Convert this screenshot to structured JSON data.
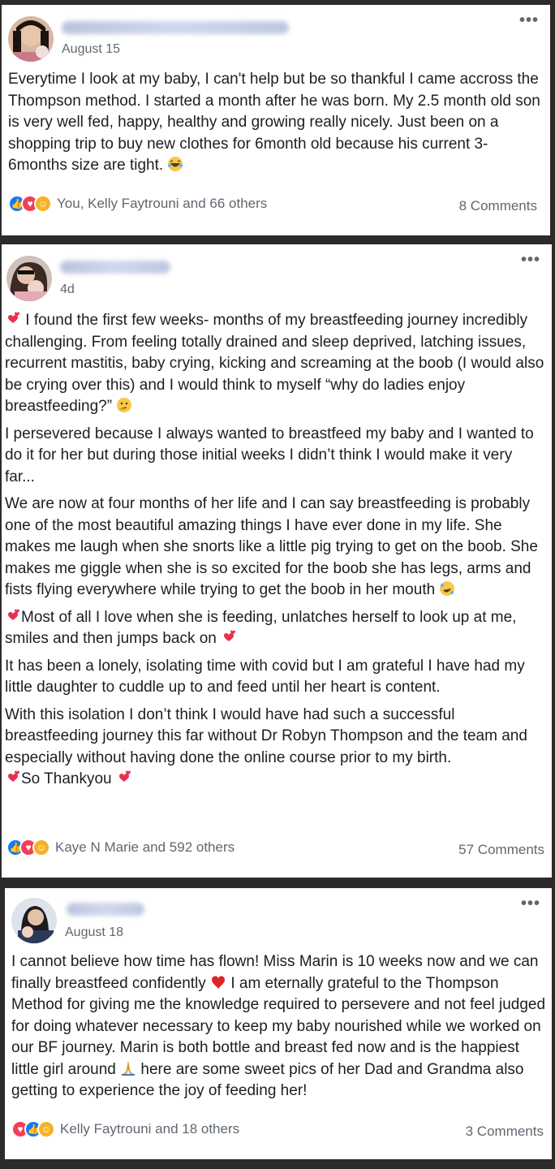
{
  "posts": [
    {
      "date": "August 15",
      "paragraphs": [
        "Everytime I look at my baby, I can't help but be so thankful I came accross the Thompson method. I started a month after he was born. My 2.5 month old son is very well fed, happy, healthy and growing really nicely. Just been on a shopping trip to buy new clothes for 6month old because his current 3-6months size are tight."
      ],
      "reactions_text": "You, Kelly Faytrouni and 66 others",
      "comments": "8 Comments"
    },
    {
      "date": "4d",
      "paragraphs": [
        "I found the first few weeks- months of my breastfeeding journey incredibly challenging. From feeling totally drained and sleep deprived, latching issues, recurrent mastitis, baby crying, kicking and screaming at the boob (I would also be crying over this) and I would think to myself “why do ladies enjoy breastfeeding?”",
        "I persevered because I always wanted to breastfeed my baby and I wanted to do it for her but during those initial weeks I didn’t think I would make it very far...",
        "We are now at four months of her life and I can say breastfeeding is probably one of the most beautiful amazing things I have ever done in my life. She makes me laugh when she snorts like a little pig trying to get on the boob. She makes me giggle when she is so excited for the boob she has legs, arms and fists flying everywhere while trying to get the boob in her mouth",
        "Most of all I love when she is feeding, unlatches herself to look up at me, smiles and then jumps back on",
        "It has been a lonely, isolating time with covid but I am grateful I have had my little daughter to cuddle up to and feed until her heart is content.",
        "With this isolation I don’t think I would have had such a successful breastfeeding journey this far without Dr Robyn Thompson and the team and especially without having done the online course prior to my birth.",
        "So Thankyou"
      ],
      "reactions_text": "Kaye N Marie and 592 others",
      "comments": "57 Comments"
    },
    {
      "date": "August 18",
      "paragraphs": [
        "I cannot believe how time has flown! Miss Marin is 10 weeks now and we can finally breastfeed confidently",
        "I am eternally grateful to the Thompson Method for giving me the knowledge required to persevere and not feel judged for doing whatever necessary to keep my baby nourished while we worked on our BF journey. Marin is both bottle and breast fed now and is the happiest little girl around",
        "here are some sweet pics of her Dad and Grandma also getting to experience the joy of feeding her!"
      ],
      "reactions_text": "Kelly Faytrouni and 18 others",
      "comments": "3 Comments"
    }
  ],
  "icons": {
    "more": "•••",
    "like": "👍",
    "love": "♥",
    "care": "☺"
  },
  "colors": {
    "like": "#1877f2",
    "love": "#f33e58",
    "care": "#f7b125"
  }
}
